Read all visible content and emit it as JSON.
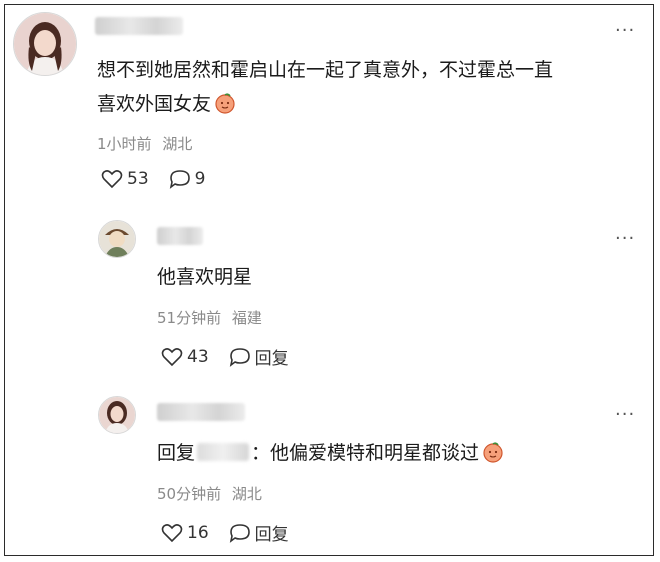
{
  "comments": [
    {
      "text_line1": "想不到她居然和霍启山在一起了真意外，不过霍总一直",
      "text_line2": "喜欢外国女友",
      "time": "1小时前",
      "location": "湖北",
      "likes": "53",
      "replies": "9"
    },
    {
      "text": "他喜欢明星",
      "time": "51分钟前",
      "location": "福建",
      "likes": "43",
      "reply_label": "回复"
    },
    {
      "reply_prefix": "回复",
      "text": "：他偏爱模特和明星都谈过",
      "time": "50分钟前",
      "location": "湖北",
      "likes": "16",
      "reply_label": "回复"
    }
  ],
  "more_glyph": "···",
  "icons": [
    "heart-outline-icon",
    "speech-bubble-icon",
    "more-dots-icon",
    "peach-emoji-icon"
  ],
  "colors": {
    "meta": "#8a8a8a",
    "text": "#1b1b1b",
    "border": "#2b2b2b"
  }
}
